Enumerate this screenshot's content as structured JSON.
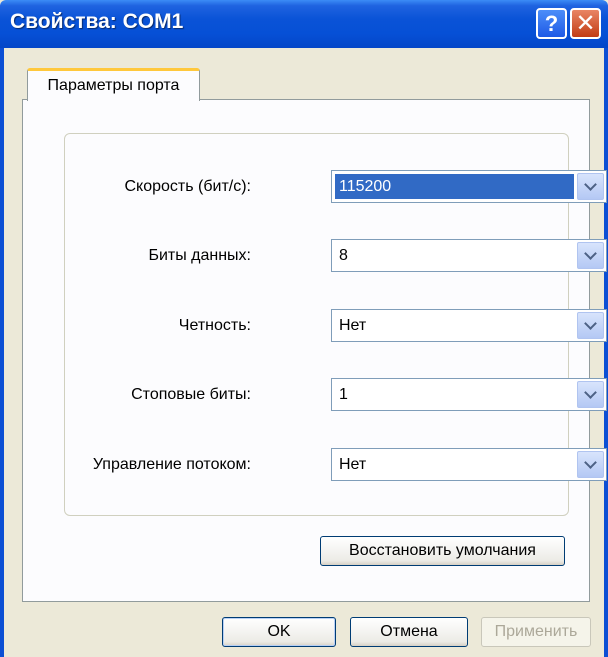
{
  "window": {
    "title": "Свойства: COM1",
    "help_label": "?",
    "close_label": "✕"
  },
  "tabs": [
    {
      "label": "Параметры порта",
      "active": true
    }
  ],
  "settings": {
    "rows": [
      {
        "label": "Скорость (бит/с):",
        "value": "115200",
        "selected": true
      },
      {
        "label": "Биты данных:",
        "value": "8"
      },
      {
        "label": "Четность:",
        "value": "Нет"
      },
      {
        "label": "Стоповые биты:",
        "value": "1"
      },
      {
        "label": "Управление потоком:",
        "value": "Нет"
      }
    ],
    "restore_label": "Восстановить умолчания"
  },
  "buttons": {
    "ok": "OK",
    "cancel": "Отмена",
    "apply": "Применить"
  },
  "colors": {
    "titlebar": "#0A53D7",
    "selection": "#316AC5",
    "tab_accent": "#FFC83C"
  }
}
